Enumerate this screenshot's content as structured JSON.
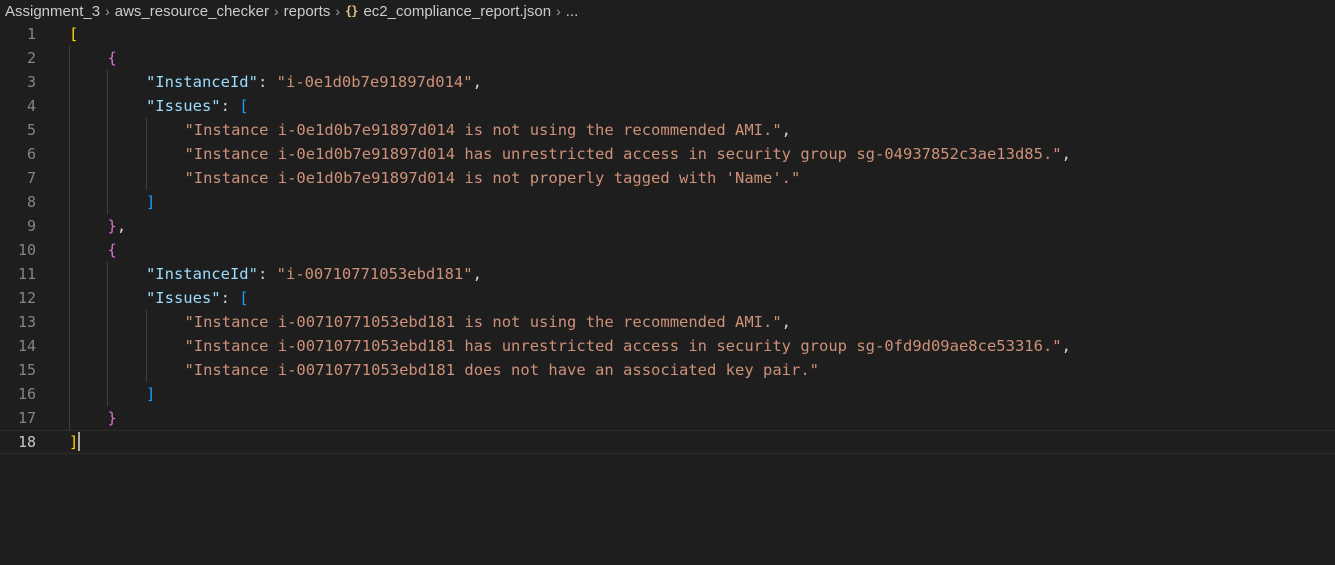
{
  "breadcrumb": {
    "items": [
      "Assignment_3",
      "aws_resource_checker",
      "reports",
      "ec2_compliance_report.json",
      "..."
    ],
    "file_icon": "json-braces-icon",
    "separator_icon": "chevron-right-icon"
  },
  "editor": {
    "file_type": "json",
    "current_line": 18,
    "line_numbers": [
      "1",
      "2",
      "3",
      "4",
      "5",
      "6",
      "7",
      "8",
      "9",
      "10",
      "11",
      "12",
      "13",
      "14",
      "15",
      "16",
      "17",
      "18"
    ],
    "records": [
      {
        "InstanceId": "i-0e1d0b7e91897d014",
        "Issues": [
          "Instance i-0e1d0b7e91897d014 is not using the recommended AMI.",
          "Instance i-0e1d0b7e91897d014 has unrestricted access in security group sg-04937852c3ae13d85.",
          "Instance i-0e1d0b7e91897d014 is not properly tagged with 'Name'."
        ]
      },
      {
        "InstanceId": "i-00710771053ebd181",
        "Issues": [
          "Instance i-00710771053ebd181 is not using the recommended AMI.",
          "Instance i-00710771053ebd181 has unrestricted access in security group sg-0fd9d09ae8ce53316.",
          "Instance i-00710771053ebd181 does not have an associated key pair."
        ]
      }
    ]
  },
  "colors": {
    "background": "#1e1e1e",
    "bracket_level1": "#ffd700",
    "bracket_level2": "#da70d6",
    "bracket_level3": "#179fff",
    "json_key": "#9cdcfe",
    "json_string": "#ce9178",
    "line_number": "#858585"
  }
}
